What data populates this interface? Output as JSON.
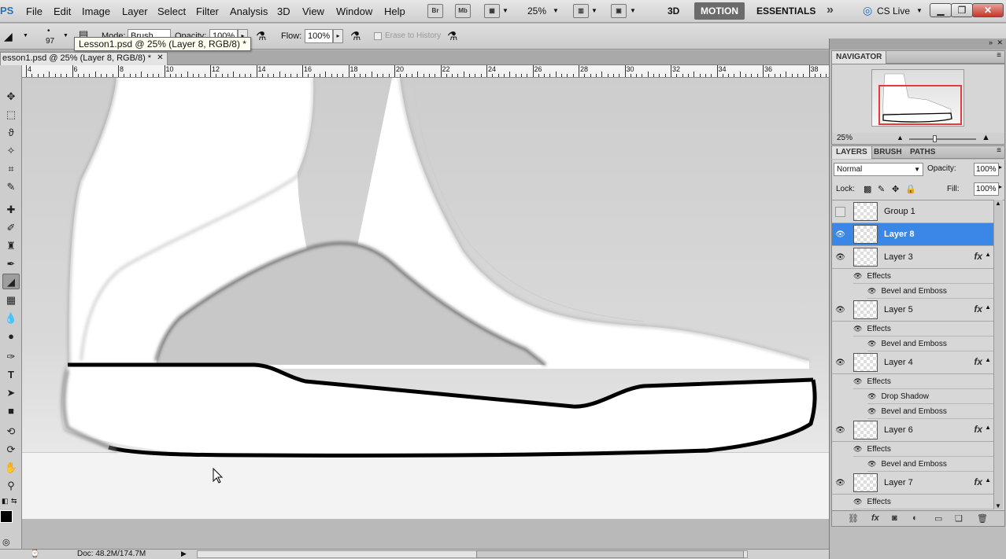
{
  "app": {
    "logo": "PS"
  },
  "menus": [
    "File",
    "Edit",
    "Image",
    "Layer",
    "Select",
    "Filter",
    "Analysis",
    "3D",
    "View",
    "Window",
    "Help"
  ],
  "menubar": {
    "bridge_btn": "Br",
    "minibridge_btn": "Mb",
    "zoom": "25%",
    "workspaces": [
      "3D",
      "MOTION",
      "ESSENTIALS"
    ],
    "more": "»",
    "cs_live": "CS Live"
  },
  "options": {
    "brush_size": "97",
    "mode_label": "Mode:",
    "mode_value": "Brush",
    "opacity_label": "Opacity:",
    "opacity_value": "100%",
    "flow_label": "Flow:",
    "flow_value": "100%",
    "erase_history": "Erase to History"
  },
  "tooltip": "Lesson1.psd @ 25% (Layer 8, RGB/8) *",
  "doc_tab": {
    "title": "esson1.psd @ 25% (Layer 8, RGB/8) *",
    "close": "✕"
  },
  "ruler_labels": [
    "4",
    "6",
    "8",
    "10",
    "12",
    "14",
    "16",
    "18",
    "20",
    "22",
    "24",
    "26",
    "28",
    "30",
    "32",
    "34",
    "36",
    "38"
  ],
  "navigator": {
    "title": "NAVIGATOR",
    "zoom": "25%"
  },
  "layers_panel": {
    "tabs": [
      "LAYERS",
      "BRUSH",
      "PATHS"
    ],
    "blend_mode": "Normal",
    "opacity_label": "Opacity:",
    "opacity_value": "100%",
    "lock_label": "Lock:",
    "fill_label": "Fill:",
    "fill_value": "100%",
    "layers": [
      {
        "name": "Group 1",
        "visible": false,
        "selected": false,
        "fx": false,
        "effects": []
      },
      {
        "name": "Layer 8",
        "visible": true,
        "selected": true,
        "fx": false,
        "effects": []
      },
      {
        "name": "Layer 3",
        "visible": true,
        "selected": false,
        "fx": true,
        "effects": [
          "Bevel and Emboss"
        ]
      },
      {
        "name": "Layer 5",
        "visible": true,
        "selected": false,
        "fx": true,
        "effects": [
          "Bevel and Emboss"
        ]
      },
      {
        "name": "Layer 4",
        "visible": true,
        "selected": false,
        "fx": true,
        "effects": [
          "Drop Shadow",
          "Bevel and Emboss"
        ]
      },
      {
        "name": "Layer 6",
        "visible": true,
        "selected": false,
        "fx": true,
        "effects": [
          "Bevel and Emboss"
        ]
      },
      {
        "name": "Layer 7",
        "visible": true,
        "selected": false,
        "fx": true,
        "effects": []
      }
    ],
    "effects_label": "Effects",
    "fx_label": "fx"
  },
  "status": {
    "doc": "Doc: 48.2M/174.7M"
  }
}
